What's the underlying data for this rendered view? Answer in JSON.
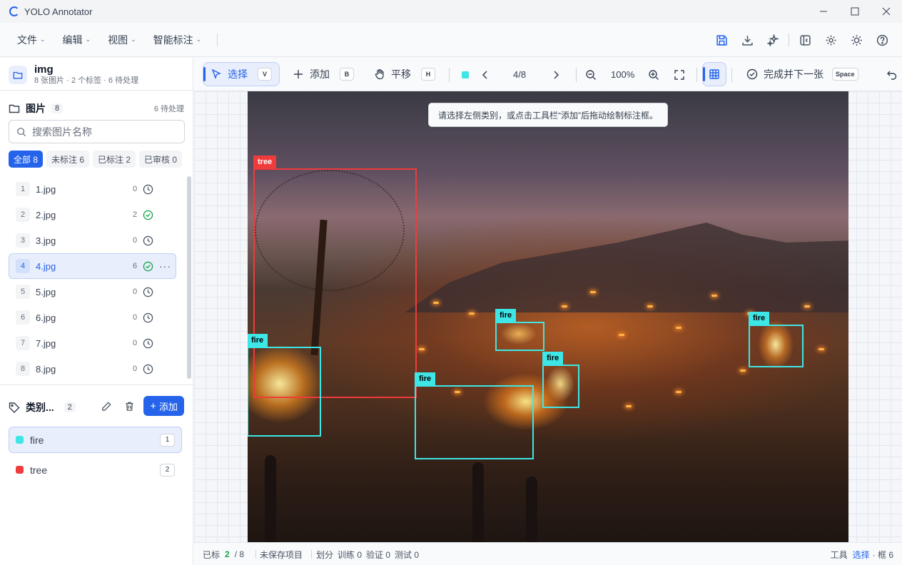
{
  "app": {
    "title": "YOLO Annotator"
  },
  "menu": {
    "items": [
      {
        "label": "文件"
      },
      {
        "label": "编辑"
      },
      {
        "label": "视图"
      },
      {
        "label": "智能标注"
      }
    ],
    "right_icons": [
      "save-icon",
      "download-icon",
      "sparkle-icon",
      "panel-toggle-icon",
      "gear-icon",
      "sun-icon",
      "help-icon"
    ]
  },
  "project": {
    "name": "img",
    "meta": "8 张图片 · 2 个标签 · 6 待处理"
  },
  "images": {
    "title": "图片",
    "count": "8",
    "pending": "6 待处理",
    "search_placeholder": "搜索图片名称",
    "filters": [
      {
        "label": "全部 8",
        "active": true
      },
      {
        "label": "未标注 6",
        "active": false
      },
      {
        "label": "已标注 2",
        "active": false
      },
      {
        "label": "已审核 0",
        "active": false
      }
    ],
    "list": [
      {
        "index": "1",
        "name": "1.jpg",
        "boxes": "0",
        "status": "pending"
      },
      {
        "index": "2",
        "name": "2.jpg",
        "boxes": "2",
        "status": "done"
      },
      {
        "index": "3",
        "name": "3.jpg",
        "boxes": "0",
        "status": "pending"
      },
      {
        "index": "4",
        "name": "4.jpg",
        "boxes": "6",
        "status": "done",
        "selected": true
      },
      {
        "index": "5",
        "name": "5.jpg",
        "boxes": "0",
        "status": "pending"
      },
      {
        "index": "6",
        "name": "6.jpg",
        "boxes": "0",
        "status": "pending"
      },
      {
        "index": "7",
        "name": "7.jpg",
        "boxes": "0",
        "status": "pending"
      },
      {
        "index": "8",
        "name": "8.jpg",
        "boxes": "0",
        "status": "pending"
      }
    ],
    "more_glyph": "···"
  },
  "classes": {
    "title": "类别...",
    "count": "2",
    "add_label": "添加",
    "list": [
      {
        "name": "fire",
        "color": "#3ee6e6",
        "key": "1",
        "selected": true
      },
      {
        "name": "tree",
        "color": "#ef3b3b",
        "key": "2",
        "selected": false
      }
    ]
  },
  "toolbar": {
    "select_label": "选择",
    "select_key": "V",
    "add_label": "添加",
    "add_key": "B",
    "pan_label": "平移",
    "pan_key": "H",
    "nav": "4/8",
    "zoom": "100%",
    "complete_label": "完成并下一张",
    "complete_key": "Space"
  },
  "canvas": {
    "hint": "请选择左侧类别，或点击工具栏“添加”后拖动绘制标注框。",
    "annotations": [
      {
        "class": "tree",
        "label": "tree"
      },
      {
        "class": "fire",
        "label": "fire"
      },
      {
        "class": "fire",
        "label": "fire"
      },
      {
        "class": "fire",
        "label": "fire"
      },
      {
        "class": "fire",
        "label": "fire"
      },
      {
        "class": "fire",
        "label": "fire"
      }
    ]
  },
  "statusbar": {
    "labeled_prefix": "已标",
    "labeled_count": "2",
    "labeled_total": "/ 8",
    "unsaved": "未保存项目",
    "split_label": "划分",
    "train": "训练 0",
    "val": "验证 0",
    "test": "测试 0",
    "tool_label": "工具",
    "tool_value": "选择",
    "box_label": "· 框 6"
  }
}
